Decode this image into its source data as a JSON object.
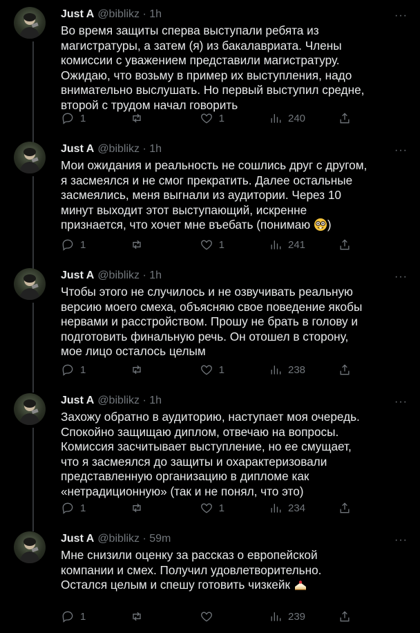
{
  "tweets": [
    {
      "author": "Just A",
      "handle": "@biblikz",
      "time": "1h",
      "text": "Во время защиты сперва выступали ребята из\nмагистратуры, а затем (я) из бакалавриата. Члены\nкомиссии с уважением представили магистратуру.\nОжидаю, что возьму в пример их выступления, надо\nвнимательно выслушать. Но первый выступил средне,\nвторой с трудом начал говорить",
      "replies": "1",
      "retweets": "",
      "likes": "1",
      "views": "240"
    },
    {
      "author": "Just A",
      "handle": "@biblikz",
      "time": "1h",
      "text": "Мои ожидания и реальность не сошлись друг с другом,\nя засмеялся и не смог прекратить. Далее остальные\nзасмеялись, меня выгнали из аудитории. Через 10\nминут выходит этот выступающий, искренне\nпризнается, что хочет мне въебать (понимаю ",
      "text_tail": ")",
      "emoji": "nerd-face",
      "replies": "1",
      "retweets": "",
      "likes": "1",
      "views": "241"
    },
    {
      "author": "Just A",
      "handle": "@biblikz",
      "time": "1h",
      "text": "Чтобы этого не случилось и не озвучивать реальную\nверсию моего смеха, объясняю свое поведение якобы\nнервами и расстройством. Прошу не брать в голову и\nподготовить финальную речь. Он отошел в сторону,\nмое лицо осталось целым",
      "replies": "1",
      "retweets": "",
      "likes": "1",
      "views": "238"
    },
    {
      "author": "Just A",
      "handle": "@biblikz",
      "time": "1h",
      "text": "Захожу обратно в аудиторию, наступает моя очередь.\nСпокойно защищаю диплом, отвечаю на вопросы.\nКомиссия засчитывает выступление, но ее смущает,\nчто я засмеялся до защиты и охарактеризовали\nпредставленную организацию в дипломе как\n«нетрадиционную» (так и не понял, что это)",
      "replies": "1",
      "retweets": "",
      "likes": "1",
      "views": "234"
    },
    {
      "author": "Just A",
      "handle": "@biblikz",
      "time": "59m",
      "text": "Мне снизили оценку за рассказ о европейской\nкомпании и смех. Получил удовлетворительно.\nОстался целым и спешу готовить чизкейк ",
      "emoji": "cheesecake",
      "replies": "1",
      "retweets": "",
      "likes": "",
      "views": "239"
    }
  ],
  "separator": "·",
  "more_label": "···",
  "icons": [
    "reply-icon",
    "retweet-icon",
    "like-icon",
    "views-icon",
    "share-icon",
    "more-icon",
    "nerd-face-emoji",
    "cheesecake-emoji"
  ]
}
